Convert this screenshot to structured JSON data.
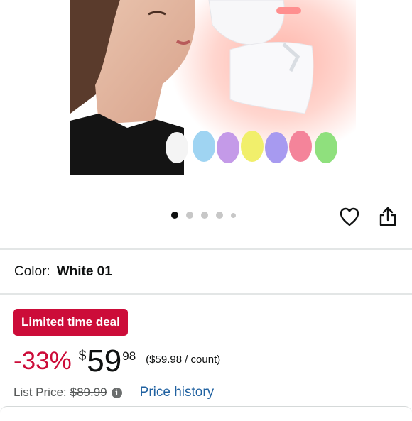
{
  "gallery": {
    "image_alt": "LED light therapy face and neck mask product image",
    "dots_count": 5,
    "active_dot": 1
  },
  "actions": {
    "wishlist_icon": "heart-icon",
    "share_icon": "share-icon"
  },
  "variant": {
    "label": "Color:",
    "value": "White 01"
  },
  "deal": {
    "badge": "Limited time deal"
  },
  "price": {
    "discount": "-33%",
    "currency": "$",
    "whole": "59",
    "fraction": "98",
    "per_unit": "($59.98 / count)",
    "list_label": "List Price:",
    "list_value": "$89.99",
    "history_link": "Price history"
  },
  "colors": {
    "deal_red": "#cc0c39",
    "link_blue": "#2162a1"
  }
}
